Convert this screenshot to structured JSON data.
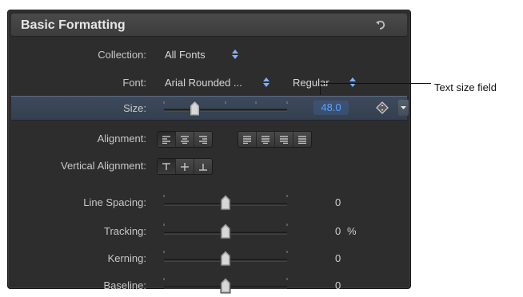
{
  "header": {
    "title": "Basic Formatting"
  },
  "collection": {
    "label": "Collection:",
    "value": "All Fonts"
  },
  "font": {
    "label": "Font:",
    "family": "Arial Rounded ...",
    "style": "Regular"
  },
  "size": {
    "label": "Size:",
    "value": "48.0",
    "slider_fraction": 0.25
  },
  "alignment": {
    "label": "Alignment:"
  },
  "vertical_alignment": {
    "label": "Vertical Alignment:"
  },
  "line_spacing": {
    "label": "Line Spacing:",
    "value": "0",
    "slider_fraction": 0.5
  },
  "tracking": {
    "label": "Tracking:",
    "value": "0",
    "unit": "%",
    "slider_fraction": 0.5
  },
  "kerning": {
    "label": "Kerning:",
    "value": "0",
    "slider_fraction": 0.5
  },
  "baseline": {
    "label": "Baseline:",
    "value": "0",
    "slider_fraction": 0.5
  },
  "callout": {
    "text": "Text size field"
  },
  "colors": {
    "panel": "#2d2d2d",
    "highlight": "#3a4658",
    "value_accent": "#5ea2ff"
  }
}
